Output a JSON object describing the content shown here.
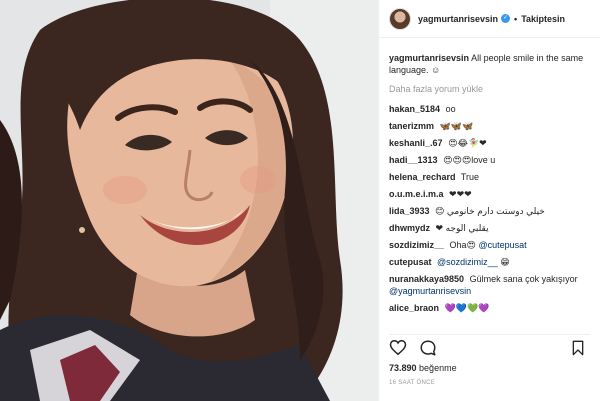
{
  "header": {
    "username": "yagmurtanrisevsin",
    "separator": "•",
    "follow_label": "Takiptesin"
  },
  "caption": {
    "username": "yagmurtanrisevsin",
    "text": "All people smile in the same language. ☺"
  },
  "load_more": "Daha fazla yorum yükle",
  "comments": [
    {
      "user": "hakan_5184",
      "text": "oo"
    },
    {
      "user": "tanerizmm",
      "text": "🦋🦋🦋"
    },
    {
      "user": "keshanli_.67",
      "text": "😍😂🧚‍♀️❤"
    },
    {
      "user": "hadi__1313",
      "text": "😍😍😍love u"
    },
    {
      "user": "helena_rechard",
      "text": "True"
    },
    {
      "user": "o.u.m.e.i.m.a",
      "text": "❤❤❤"
    },
    {
      "user": "lida_3933",
      "text": "خيلي دوستت دارم خانومي 😊"
    },
    {
      "user": "dhwmydz",
      "text": "يقلبي الوجه ❤"
    },
    {
      "user": "sozdizimiz__",
      "text": "Oha😍",
      "mention": "@cutepusat"
    },
    {
      "user": "cutepusat",
      "text": "😁",
      "mention": "@sozdizimiz__"
    },
    {
      "user": "nuranakkaya9850",
      "text": "Gülmek sana çok yakışıyor",
      "mention": "@yagmurtanrisevsin"
    },
    {
      "user": "alice_braon",
      "text": "💜💙💚💜"
    }
  ],
  "likes": {
    "count": "73.890",
    "label": "beğenme"
  },
  "timestamp": "16 SAAT ÖNCE",
  "icons": {
    "verified": "verified-badge-icon",
    "like": "heart-icon",
    "comment": "comment-icon",
    "save": "bookmark-icon"
  },
  "colors": {
    "verified": "#3897f0",
    "mention": "#003569",
    "muted": "#999999"
  }
}
